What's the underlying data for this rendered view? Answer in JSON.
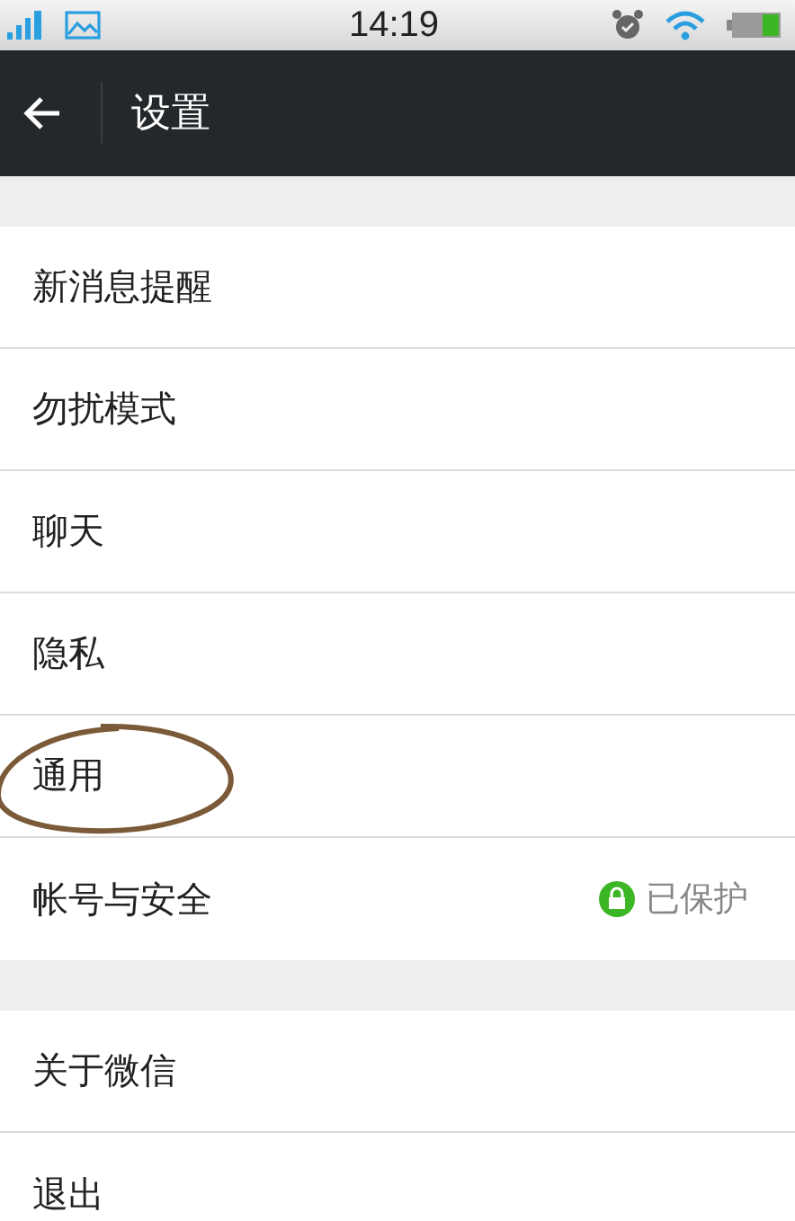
{
  "status_bar": {
    "time": "14:19"
  },
  "header": {
    "title": "设置"
  },
  "sections": [
    {
      "items": [
        {
          "label": "新消息提醒",
          "circled": false
        },
        {
          "label": "勿扰模式",
          "circled": false
        },
        {
          "label": "聊天",
          "circled": false
        },
        {
          "label": "隐私",
          "circled": false
        },
        {
          "label": "通用",
          "circled": true
        },
        {
          "label": "帐号与安全",
          "circled": false,
          "status": "已保护"
        }
      ]
    },
    {
      "items": [
        {
          "label": "关于微信",
          "circled": false
        },
        {
          "label": "退出",
          "circled": false
        }
      ]
    }
  ]
}
